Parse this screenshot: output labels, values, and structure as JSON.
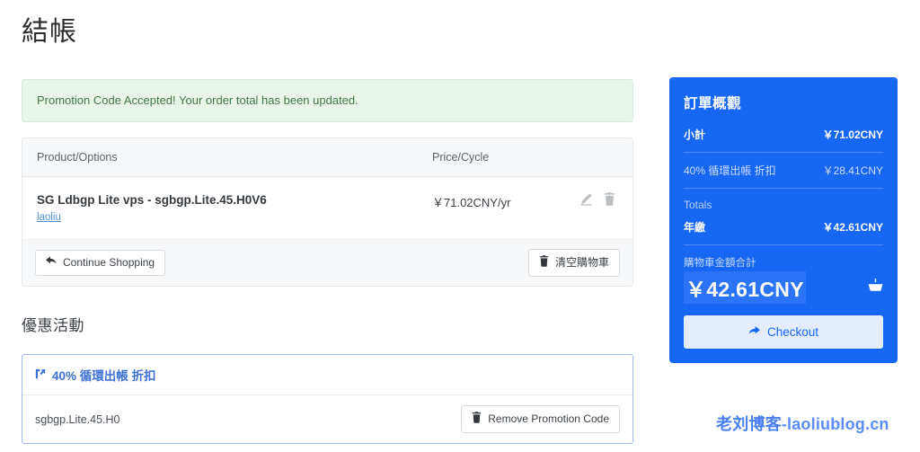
{
  "page": {
    "title": "結帳"
  },
  "alert": {
    "message": "Promotion Code Accepted! Your order total has been updated."
  },
  "cart": {
    "headers": {
      "product": "Product/Options",
      "price": "Price/Cycle"
    },
    "items": [
      {
        "name": "SG Ldbgp Lite vps - sgbgp.Lite.45.H0V6",
        "sub": "laoliu",
        "price": "￥71.02CNY/yr",
        "edit_icon": "pencil-icon",
        "delete_icon": "trash-icon"
      }
    ],
    "continue_label": "Continue Shopping",
    "empty_label": "清空購物車",
    "continue_icon": "arrow-left-icon",
    "empty_icon": "trash-icon"
  },
  "promotions": {
    "section_title": "優惠活動",
    "title": "40% 循環出帳 折扣",
    "title_icon": "tag-icon",
    "code": "sgbgp.Lite.45.H0",
    "remove_label": "Remove Promotion Code",
    "remove_icon": "trash-icon"
  },
  "summary": {
    "title": "訂單概觀",
    "subtotal_label": "小計",
    "subtotal_value": "￥71.02CNY",
    "discount_label": "40% 循環出帳 折扣",
    "discount_value": "￥28.41CNY",
    "totals_label": "Totals",
    "recurring_label": "年繳",
    "recurring_value": "￥42.61CNY",
    "grand_label": "購物車金額合計",
    "grand_value": "￥42.61CNY",
    "cart_icon": "shopping-cart-icon",
    "checkout_label": "Checkout",
    "checkout_icon": "arrow-right-icon",
    "accent_color": "#1767f5"
  },
  "watermark": {
    "cn": "老刘博客",
    "domain": "-laoliublog.cn"
  }
}
